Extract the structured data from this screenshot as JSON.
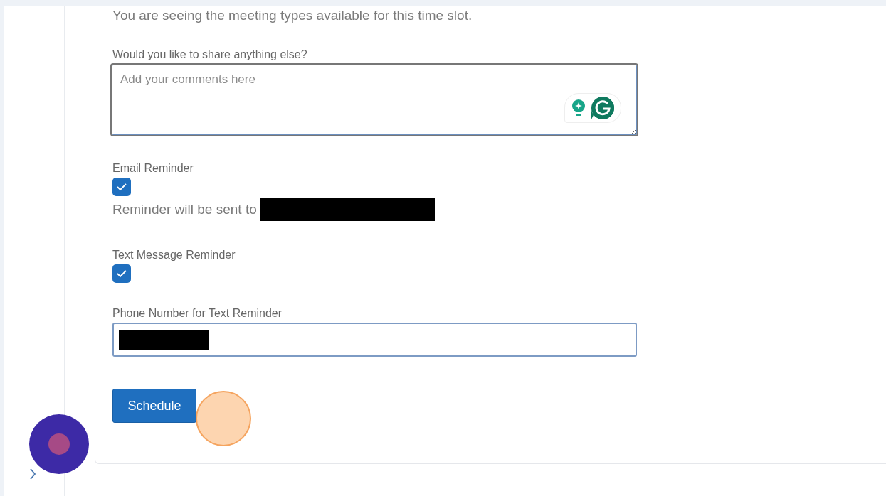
{
  "intro": "You are seeing the meeting types available for this time slot.",
  "comments": {
    "label": "Would you like to share anything else?",
    "placeholder": "Add your comments here"
  },
  "email_reminder": {
    "label": "Email Reminder",
    "checked": true,
    "note": "Reminder will be sent to"
  },
  "text_reminder": {
    "label": "Text Message Reminder",
    "checked": true
  },
  "phone": {
    "label": "Phone Number for Text Reminder"
  },
  "schedule_button": "Schedule"
}
